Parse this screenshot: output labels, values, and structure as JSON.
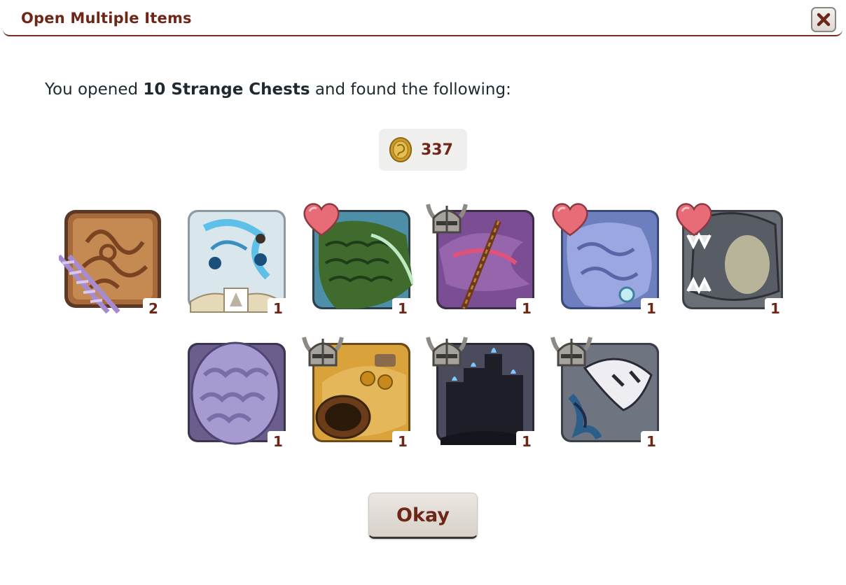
{
  "dialog": {
    "title": "Open Multiple Items",
    "close_icon": "close-x-icon"
  },
  "message": {
    "prefix": "You opened ",
    "highlight": "10 Strange Chests",
    "suffix": " and found the following:"
  },
  "currency": {
    "icon": "treasure-coin-icon",
    "amount": "337"
  },
  "items": [
    {
      "icon": "gene-scroll-icon",
      "quantity": "2",
      "badge": "dna"
    },
    {
      "icon": "apparel-set-icon",
      "quantity": "1",
      "badge": "none"
    },
    {
      "icon": "green-familiar-icon",
      "quantity": "1",
      "badge": "heart"
    },
    {
      "icon": "staff-apparel-icon",
      "quantity": "1",
      "badge": "helmet"
    },
    {
      "icon": "blue-familiar-icon",
      "quantity": "1",
      "badge": "heart"
    },
    {
      "icon": "stone-familiar-icon",
      "quantity": "1",
      "badge": "heart"
    },
    {
      "icon": "purple-egg-icon",
      "quantity": "1",
      "badge": "none"
    },
    {
      "icon": "gold-drum-apparel-icon",
      "quantity": "1",
      "badge": "helmet"
    },
    {
      "icon": "candle-scene-icon",
      "quantity": "1",
      "badge": "helmet"
    },
    {
      "icon": "skull-mask-apparel-icon",
      "quantity": "1",
      "badge": "helmet"
    }
  ],
  "colors": {
    "title": "#6e2616",
    "text": "#1f2a30",
    "heart": "#e86b78",
    "button_bg": "#e3ded7"
  },
  "okay_button": {
    "label": "Okay"
  }
}
